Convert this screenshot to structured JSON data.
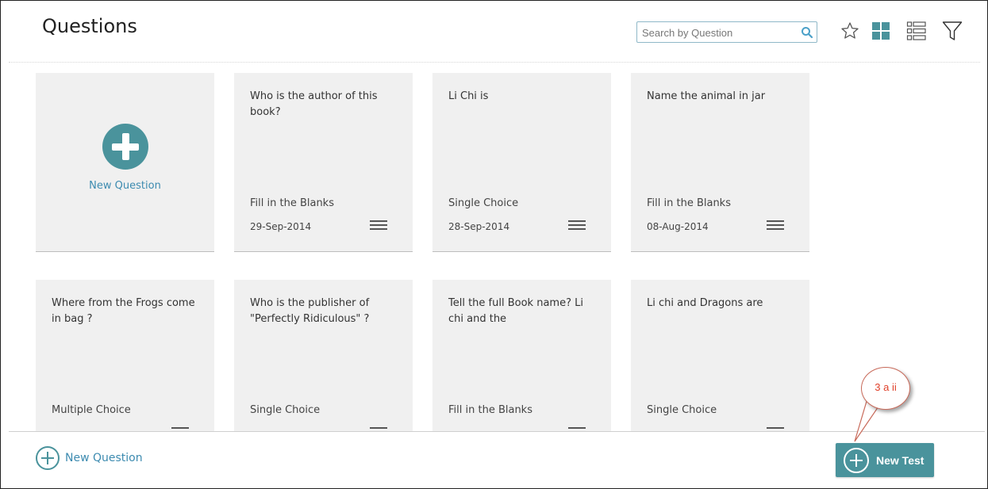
{
  "header": {
    "title": "Questions",
    "search_placeholder": "Search by Question"
  },
  "toolbar": {
    "icons": [
      "star-icon",
      "grid-view-icon",
      "list-view-icon",
      "filter-icon"
    ],
    "active_view": "grid",
    "accent": "#4a939c"
  },
  "new_question_card": {
    "label": "New Question"
  },
  "cards": [
    {
      "question": "Who is the author of this book?",
      "type": "Fill in the Blanks",
      "date": "29-Sep-2014"
    },
    {
      "question": "Li Chi is",
      "type": "Single Choice",
      "date": "28-Sep-2014"
    },
    {
      "question": "Name the animal in jar",
      "type": "Fill in the Blanks",
      "date": "08-Aug-2014"
    },
    {
      "question": "Where from the Frogs come in bag ?",
      "type": "Multiple Choice"
    },
    {
      "question": "Who is the publisher of \"Perfectly Ridiculous\" ?",
      "type": "Single Choice"
    },
    {
      "question": "Tell the full Book name? Li chi and the",
      "type": "Fill in the Blanks"
    },
    {
      "question": "Li chi and Dragons are",
      "type": "Single Choice"
    }
  ],
  "footer": {
    "new_question_label": "New Question",
    "new_test_label": "New Test"
  },
  "callout": {
    "text": "3 a ii",
    "color": "#e0402a"
  }
}
